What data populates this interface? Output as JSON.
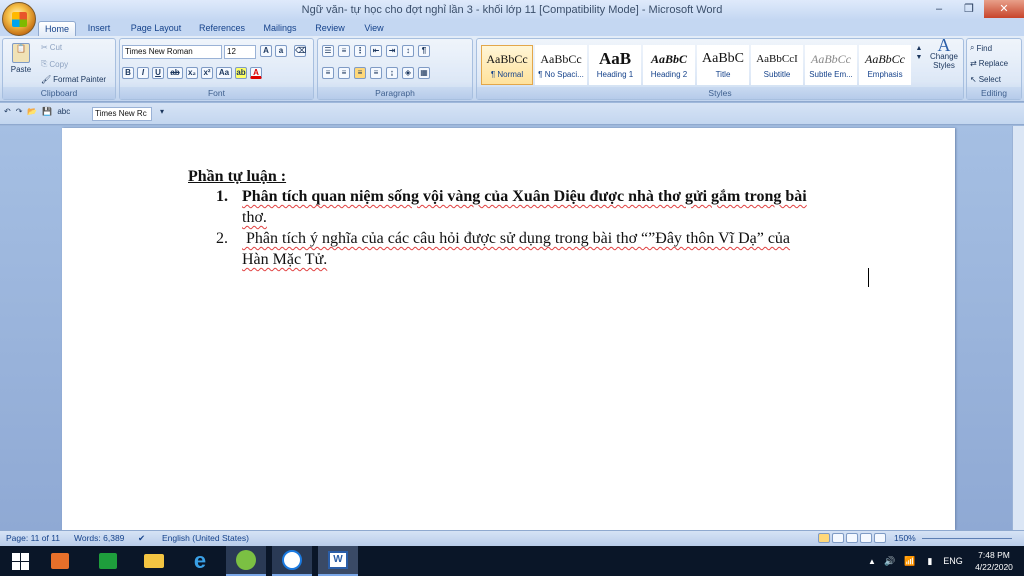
{
  "window": {
    "title": "Ngữ văn- tự học cho đợt nghỉ lần 3 - khối lớp 11 [Compatibility Mode] - Microsoft Word"
  },
  "tabs": [
    "Home",
    "Insert",
    "Page Layout",
    "References",
    "Mailings",
    "Review",
    "View"
  ],
  "clipboard": {
    "paste": "Paste",
    "cut": "Cut",
    "copy": "Copy",
    "format_painter": "Format Painter",
    "label": "Clipboard"
  },
  "font": {
    "name": "Times New Roman",
    "size": "12",
    "label": "Font"
  },
  "paragraph": {
    "label": "Paragraph"
  },
  "styles": {
    "label": "Styles",
    "items": [
      {
        "sample": "AaBbCc",
        "name": "¶ Normal"
      },
      {
        "sample": "AaBbCc",
        "name": "¶ No Spaci..."
      },
      {
        "sample": "AaB",
        "name": "Heading 1"
      },
      {
        "sample": "AaBbC",
        "name": "Heading 2"
      },
      {
        "sample": "AaBbC",
        "name": "Title"
      },
      {
        "sample": "AaBbCcI",
        "name": "Subtitle"
      },
      {
        "sample": "AaBbCc",
        "name": "Subtle Em..."
      },
      {
        "sample": "AaBbCc",
        "name": "Emphasis"
      }
    ],
    "change": "Change Styles"
  },
  "editing": {
    "label": "Editing",
    "find": "Find",
    "replace": "Replace",
    "select": "Select"
  },
  "qat": {
    "font_box": "Times New Rc"
  },
  "document": {
    "heading": "Phần tự luận :",
    "items": [
      {
        "num": "1.",
        "line1": "Phân tích quan niệm sống vội vàng của Xuân Diệu được nhà thơ gửi gắm trong bài",
        "line2": "thơ."
      },
      {
        "num": "2.",
        "line1": " Phân tích ý nghĩa của các câu hỏi được sử dụng trong bài thơ “”Đây thôn Vĩ Dạ” của",
        "line2": "Hàn Mặc Tử."
      }
    ]
  },
  "status": {
    "page": "Page: 11 of 11",
    "words": "Words: 6,389",
    "language": "English (United States)",
    "zoom": "150%"
  },
  "taskbar": {
    "time": "7:48 PM",
    "date": "4/22/2020",
    "lang": "ENG"
  }
}
